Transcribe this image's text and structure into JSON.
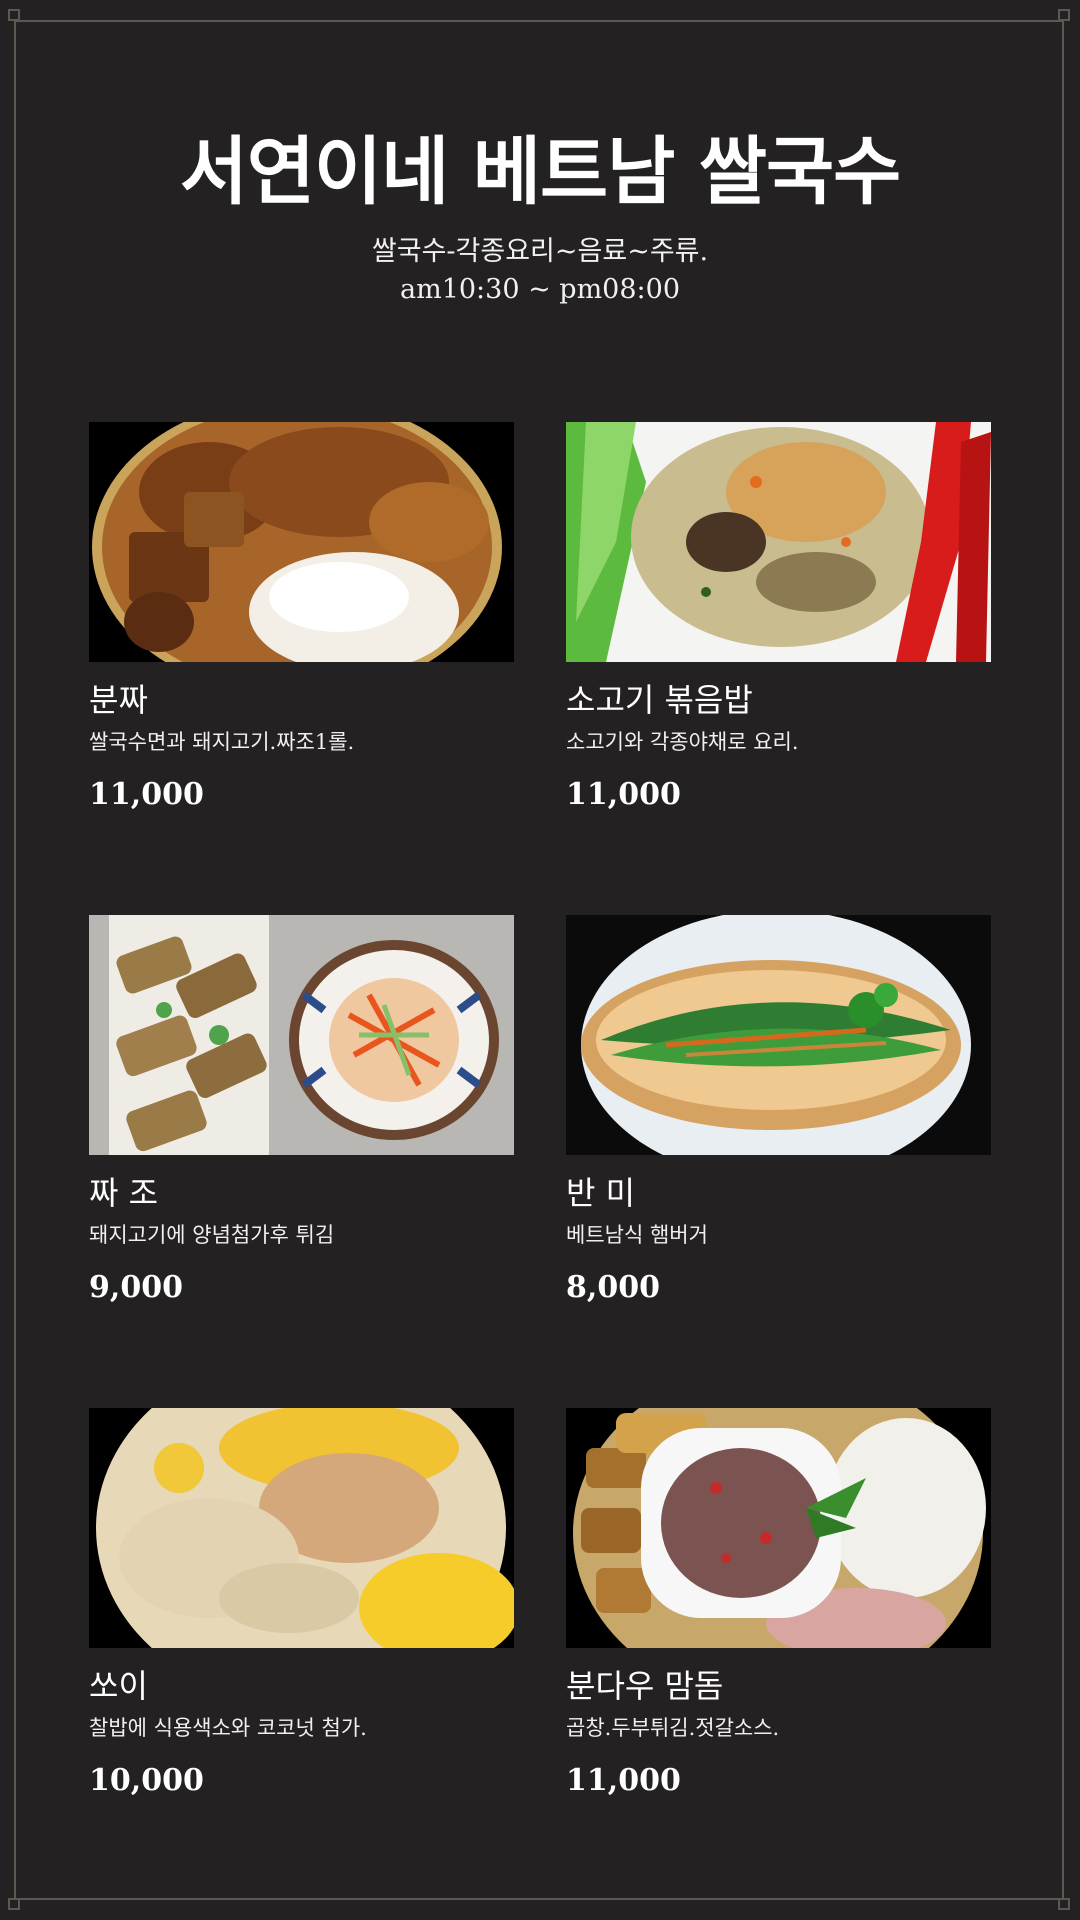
{
  "header": {
    "title": "서연이네 베트남 쌀국수",
    "subtitle_line1": "쌀국수-각종요리~음료~주류.",
    "subtitle_line2": "am10:30 ~ pm08:00"
  },
  "menu": [
    {
      "name": "분짜",
      "desc": "쌀국수면과 돼지고기.짜조1롤.",
      "price": "11,000"
    },
    {
      "name": "소고기 볶음밥",
      "desc": "소고기와 각종야채로 요리.",
      "price": "11,000"
    },
    {
      "name": "짜 조",
      "desc": "돼지고기에 양념첨가후 튀김",
      "price": "9,000"
    },
    {
      "name": "반  미",
      "desc": "베트남식 햄버거",
      "price": "8,000"
    },
    {
      "name": "쏘이",
      "desc": "찰밥에 식용색소와 코코넛 첨가.",
      "price": "10,000"
    },
    {
      "name": "분다우 맘돔",
      "desc": "곱창.두부튀김.젓갈소스.",
      "price": "11,000"
    }
  ],
  "colors": {
    "background": "#242122",
    "frame": "#5e5852",
    "text": "#ffffff"
  }
}
